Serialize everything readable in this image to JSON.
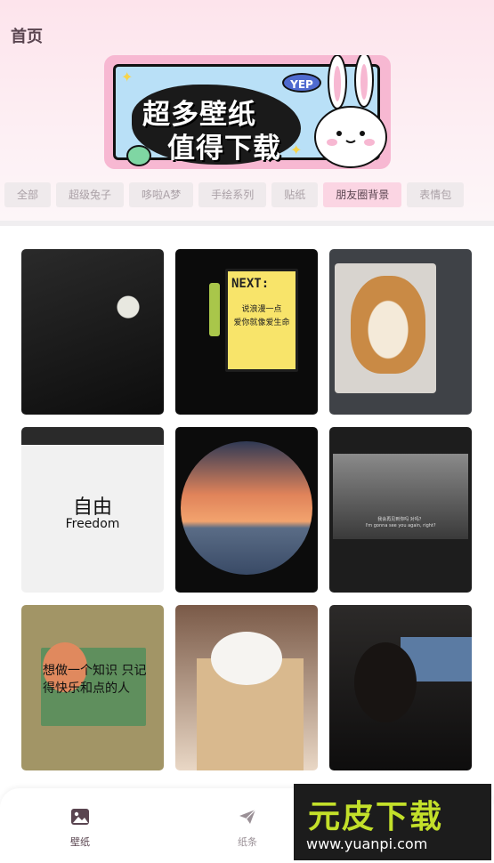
{
  "header": {
    "title": "首页"
  },
  "banner": {
    "line1": "超多壁纸",
    "line2": "值得下载",
    "badge": "YEP"
  },
  "tabs": [
    {
      "label": "全部",
      "active": false
    },
    {
      "label": "超级兔子",
      "active": false
    },
    {
      "label": "哆啦A梦",
      "active": false
    },
    {
      "label": "手绘系列",
      "active": false
    },
    {
      "label": "贴纸",
      "active": false
    },
    {
      "label": "朋友圈背景",
      "active": true
    },
    {
      "label": "表情包",
      "active": false
    }
  ],
  "grid": {
    "card2": {
      "sign_title": "NEXT:",
      "sign_line1": "说浪漫一点",
      "sign_line2": "爱你就像爱生命"
    },
    "card4": {
      "title": "自由",
      "subtitle": "Freedom"
    },
    "card6": {
      "subtitle_cn": "我会再见到你吗 对吗？",
      "subtitle_en": "I'm gonna see you again, right?"
    },
    "card7": {
      "handwriting": "想做一个知识 只记得快乐和点的人"
    }
  },
  "bottom_nav": {
    "items": [
      {
        "label": "壁纸",
        "icon": "image-icon",
        "active": true
      },
      {
        "label": "纸条",
        "icon": "paper-plane-icon",
        "active": false
      }
    ]
  },
  "watermark": {
    "title": "元皮下载",
    "url": "www.yuanpi.com"
  },
  "colors": {
    "accent_pink": "#fbd5e3",
    "text_dark": "#5a4550"
  }
}
